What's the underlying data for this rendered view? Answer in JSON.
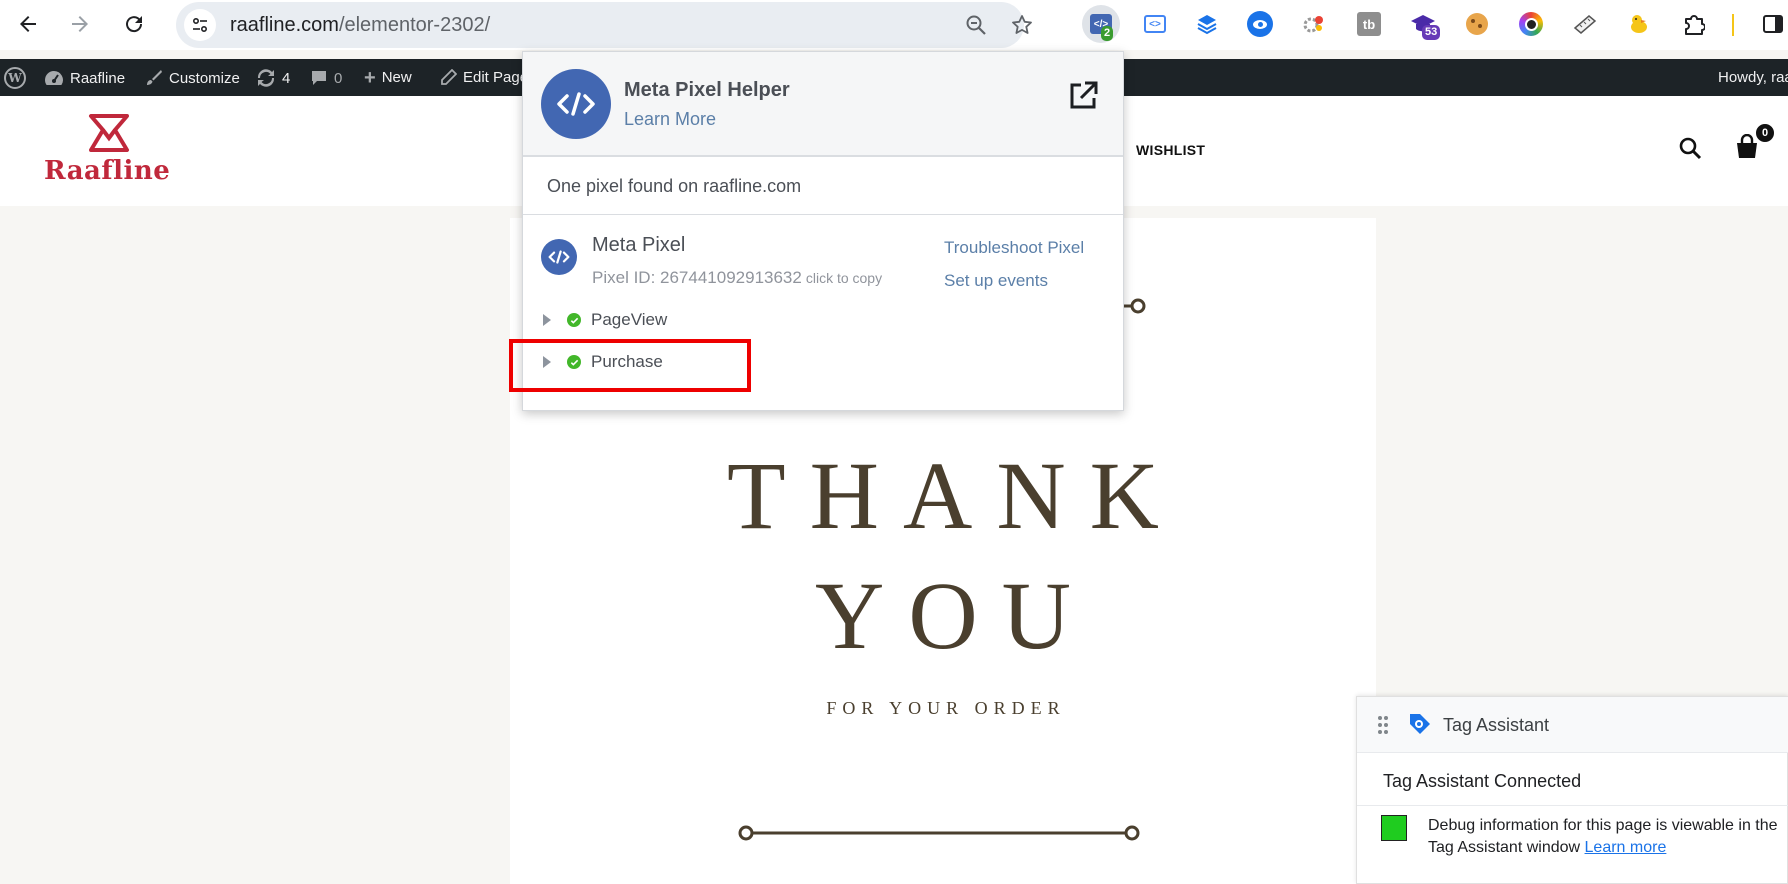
{
  "browser": {
    "url_host": "raafline.com",
    "url_path": "/elementor-2302/",
    "extensions": [
      {
        "name": "meta-pixel-helper-icon",
        "badge": "2",
        "badge_color": "#3a9b2f"
      },
      {
        "name": "google-tag-icon"
      },
      {
        "name": "layers-icon"
      },
      {
        "name": "eye-icon"
      },
      {
        "name": "colorful-gear-icon"
      },
      {
        "name": "tb-icon"
      },
      {
        "name": "graduation-cap-icon",
        "badge": "53",
        "badge_color": "#673ab7"
      },
      {
        "name": "cookie-icon"
      },
      {
        "name": "color-circle-icon"
      },
      {
        "name": "ruler-icon"
      },
      {
        "name": "duck-icon"
      },
      {
        "name": "puzzle-icon"
      }
    ]
  },
  "adminbar": {
    "site_name": "Raafline",
    "customize": "Customize",
    "updates": "4",
    "comments": "0",
    "new": "New",
    "edit_page": "Edit Page",
    "howdy": "Howdy, raa"
  },
  "site": {
    "logo": "Raafline",
    "logo_color": "#c0283b",
    "nav_wishlist": "WISHLIST",
    "cart_count": "0"
  },
  "card": {
    "line1": "THANK",
    "line2": "YOU",
    "sub": "FOR YOUR ORDER",
    "accent": "#4a3f2e"
  },
  "popup": {
    "title": "Meta Pixel Helper",
    "learn_more": "Learn More",
    "found": "One pixel found on raafline.com",
    "pixel_name": "Meta Pixel",
    "pixel_id": "Pixel ID: 267441092913632",
    "click_to_copy": "click to copy",
    "troubleshoot": "Troubleshoot Pixel",
    "setup_events": "Set up events",
    "events": [
      "PageView",
      "Purchase"
    ],
    "brand_color": "#4267b2"
  },
  "tag_assistant": {
    "title": "Tag Assistant",
    "connected": "Tag Assistant Connected",
    "debug": "Debug information for this page is viewable in the Tag Assistant window",
    "learn_more": "Learn more"
  }
}
